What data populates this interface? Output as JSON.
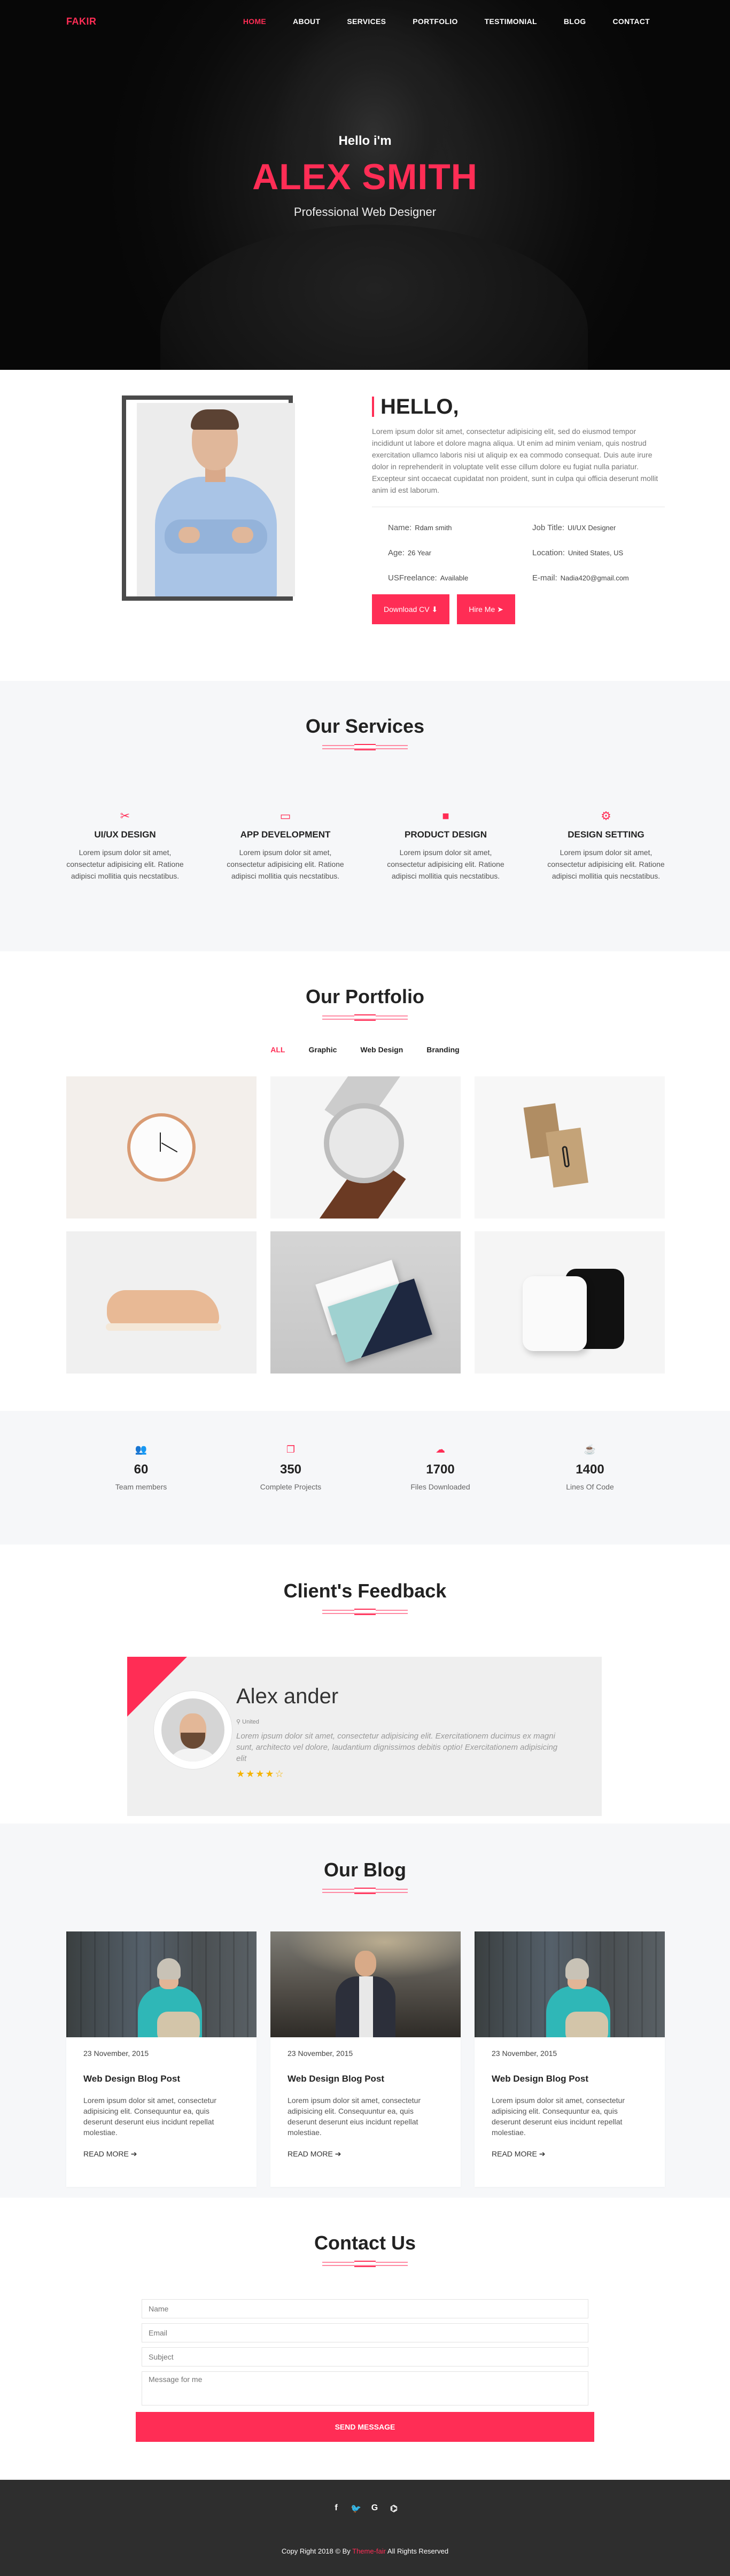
{
  "nav": {
    "logo": "FAKIR",
    "items": [
      "HOME",
      "ABOUT",
      "SERVICES",
      "PORTFOLIO",
      "TESTIMONIAL",
      "BLOG",
      "CONTACT"
    ],
    "active": "HOME"
  },
  "hero": {
    "greeting": "Hello i'm",
    "name": "ALEX SMITH",
    "role": "Professional Web Designer"
  },
  "about": {
    "title": "HELLO,",
    "text": "Lorem ipsum dolor sit amet, consectetur adipisicing elit, sed do eiusmod tempor incididunt ut labore et dolore magna aliqua. Ut enim ad minim veniam, quis nostrud exercitation ullamco laboris nisi ut aliquip ex ea commodo consequat. Duis aute irure dolor in reprehenderit in voluptate velit esse cillum dolore eu fugiat nulla pariatur. Excepteur sint occaecat cupidatat non proident, sunt in culpa qui officia deserunt mollit anim id est laborum.",
    "info": [
      {
        "key": "Name:",
        "value": "Rdam smith"
      },
      {
        "key": "Job Title:",
        "value": "UI/UX Designer"
      },
      {
        "key": "Age:",
        "value": "26 Year"
      },
      {
        "key": "Location:",
        "value": "United States, US"
      },
      {
        "key": "USFreelance:",
        "value": "Available"
      },
      {
        "key": "E-mail:",
        "value": "Nadia420@gmail.com"
      }
    ],
    "download_label": "Download CV",
    "hire_label": "Hire Me"
  },
  "services": {
    "title": "Our Services",
    "items": [
      {
        "icon": "tools-icon",
        "title": "UI/UX DESIGN",
        "text": "Lorem ipsum dolor sit amet, consectetur adipisicing elit. Ratione adipisci mollitia quis necstatibus."
      },
      {
        "icon": "laptop-icon",
        "title": "APP DEVELOPMENT",
        "text": "Lorem ipsum dolor sit amet, consectetur adipisicing elit. Ratione adipisci mollitia quis necstatibus."
      },
      {
        "icon": "gift-icon",
        "title": "PRODUCT DESIGN",
        "text": "Lorem ipsum dolor sit amet, consectetur adipisicing elit. Ratione adipisci mollitia quis necstatibus."
      },
      {
        "icon": "gears-icon",
        "title": "DESIGN SETTING",
        "text": "Lorem ipsum dolor sit amet, consectetur adipisicing elit. Ratione adipisci mollitia quis necstatibus."
      }
    ]
  },
  "portfolio": {
    "title": "Our Portfolio",
    "filters": [
      "ALL",
      "Graphic",
      "Web Design",
      "Branding"
    ],
    "active_filter": "ALL"
  },
  "counters": [
    {
      "icon": "users-icon",
      "number": "60",
      "label": "Team members"
    },
    {
      "icon": "copy-icon",
      "number": "350",
      "label": "Complete Projects"
    },
    {
      "icon": "cloud-download-icon",
      "number": "1700",
      "label": "Files Downloaded"
    },
    {
      "icon": "coffee-icon",
      "number": "1400",
      "label": "Lines Of Code"
    }
  ],
  "feedback": {
    "title": "Client's Feedback",
    "name": "Alex ander",
    "location": "United",
    "quote": "Lorem ipsum dolor sit amet, consectetur adipisicing elit. Exercitationem ducimus ex magni sunt, architecto vel dolore, laudantium dignissimos debitis optio! Exercitationem adipisicing elit",
    "stars": "★★★★☆"
  },
  "blog": {
    "title": "Our Blog",
    "posts": [
      {
        "date": "23 November, 2015",
        "title": "Web Design Blog Post",
        "text": "Lorem ipsum dolor sit amet, consectetur adipisicing elit. Consequuntur ea, quis deserunt deserunt eius incidunt repellat molestiae.",
        "more": "READ MORE"
      },
      {
        "date": "23 November, 2015",
        "title": "Web Design Blog Post",
        "text": "Lorem ipsum dolor sit amet, consectetur adipisicing elit. Consequuntur ea, quis deserunt deserunt eius incidunt repellat molestiae.",
        "more": "READ MORE"
      },
      {
        "date": "23 November, 2015",
        "title": "Web Design Blog Post",
        "text": "Lorem ipsum dolor sit amet, consectetur adipisicing elit. Consequuntur ea, quis deserunt deserunt eius incidunt repellat molestiae.",
        "more": "READ MORE"
      }
    ]
  },
  "contact": {
    "title": "Contact Us",
    "name_placeholder": "Name",
    "email_placeholder": "Email",
    "subject_placeholder": "Subject",
    "message_placeholder": "Message for me",
    "send_label": "SEND MESSAGE"
  },
  "footer": {
    "social": [
      "f",
      "🐦",
      "G",
      "⌬"
    ],
    "copy_prefix": "Copy Right 2018 © By",
    "copy_brand": "Theme-fair",
    "copy_suffix": "All Rights Reserved"
  },
  "colors": {
    "accent": "#ff2d55",
    "dark": "#2e2e2e",
    "light": "#f6f7f9"
  }
}
